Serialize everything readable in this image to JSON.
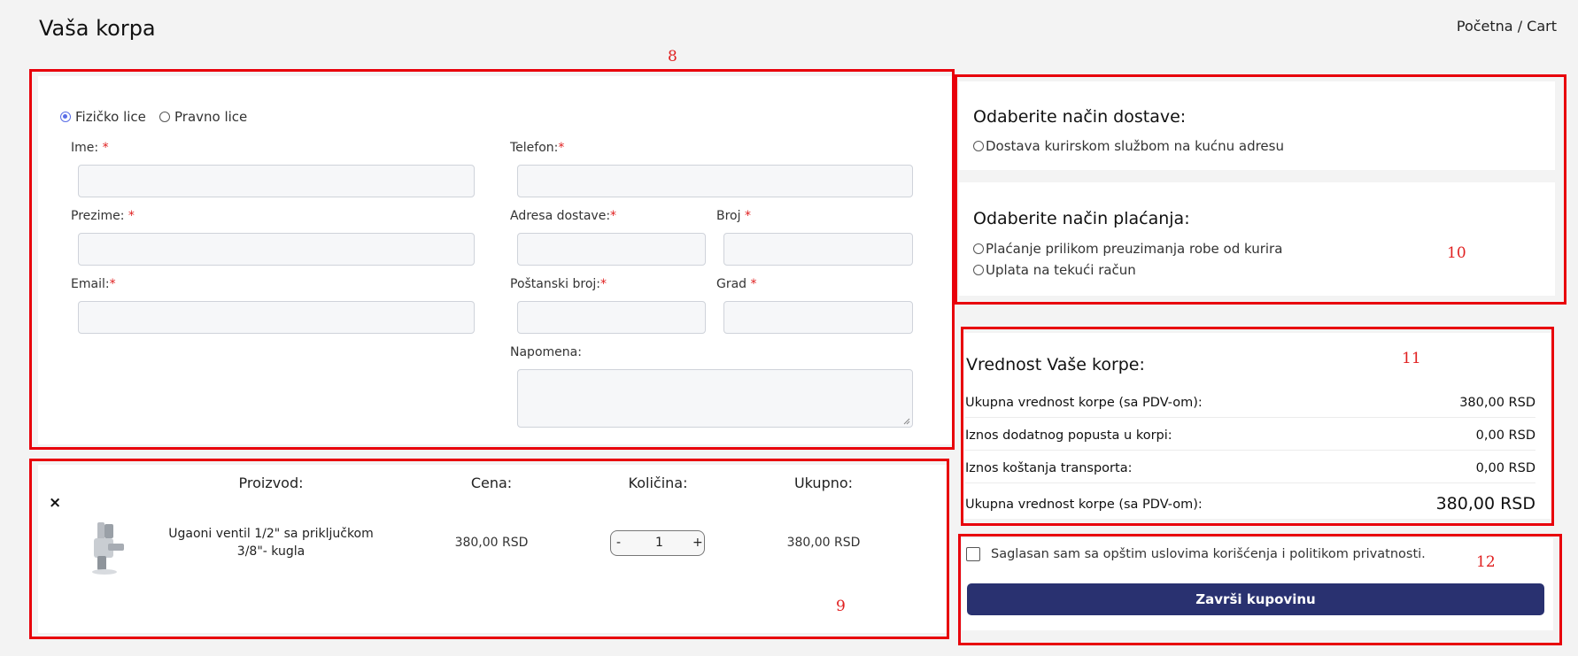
{
  "page": {
    "title": "Vaša korpa"
  },
  "breadcrumb": {
    "home": "Početna",
    "separator": " / ",
    "current": "Cart"
  },
  "annotations": {
    "a8": "8",
    "a9": "9",
    "a10": "10",
    "a11": "11",
    "a12": "12"
  },
  "customer_type": {
    "option1": "Fizičko lice",
    "option2": "Pravno lice",
    "selected": "Fizičko lice"
  },
  "form": {
    "ime": "Ime:",
    "telefon": "Telefon:",
    "prezime": "Prezime:",
    "adresa": "Adresa dostave:",
    "broj": "Broj",
    "email": "Email:",
    "postanski": "Poštanski broj:",
    "grad": "Grad",
    "napomena": "Napomena:",
    "required_mark": "*"
  },
  "shipping": {
    "heading": "Odaberite način dostave:",
    "options": [
      "Dostava kurirskom službom na kućnu adresu"
    ]
  },
  "payment": {
    "heading": "Odaberite način plaćanja:",
    "options": [
      "Plaćanje prilikom preuzimanja robe od kurira",
      "Uplata na tekući račun"
    ]
  },
  "summary": {
    "heading": "Vrednost Vaše korpe:",
    "rows": [
      {
        "label": "Ukupna vrednost korpe (sa PDV-om):",
        "value": "380,00 RSD"
      },
      {
        "label": "Iznos dodatnog popusta u korpi:",
        "value": "0,00 RSD"
      },
      {
        "label": "Iznos koštanja transporta:",
        "value": "0,00 RSD"
      },
      {
        "label": "Ukupna vrednost korpe (sa PDV-om):",
        "value": "380,00 RSD"
      }
    ]
  },
  "cart": {
    "headers": {
      "product": "Proizvod:",
      "price": "Cena:",
      "quantity": "Količina:",
      "total": "Ukupno:"
    },
    "remove_symbol": "×",
    "item": {
      "name_line1": "Ugaoni ventil 1/2\" sa priključkom",
      "name_line2": "3/8\"- kugla",
      "price": "380,00 RSD",
      "quantity": "1",
      "total": "380,00 RSD",
      "minus": "-",
      "plus": "+"
    }
  },
  "terms": {
    "label": "Saglasan sam sa opštim uslovima korišćenja i politikom privatnosti."
  },
  "checkout": {
    "button": "Završi kupovinu"
  },
  "colors": {
    "accent": "#293170",
    "annotation": "#e8000b",
    "radio": "#5a6ee6"
  }
}
